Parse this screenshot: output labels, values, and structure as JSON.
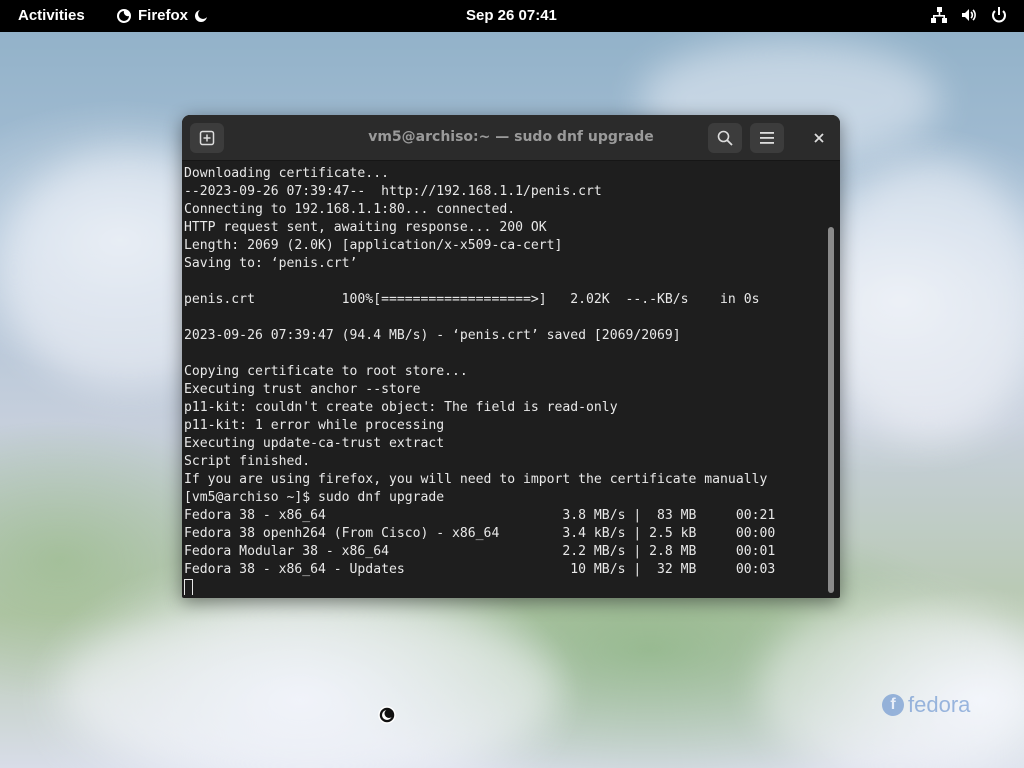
{
  "topbar": {
    "activities": "Activities",
    "app_name": "Firefox",
    "clock": "Sep 26  07:41"
  },
  "window": {
    "title": "vm5@archiso:~ — sudo dnf upgrade"
  },
  "terminal": {
    "lines": [
      "Downloading certificate...",
      "--2023-09-26 07:39:47--  http://192.168.1.1/penis.crt",
      "Connecting to 192.168.1.1:80... connected.",
      "HTTP request sent, awaiting response... 200 OK",
      "Length: 2069 (2.0K) [application/x-x509-ca-cert]",
      "Saving to: ‘penis.crt’",
      "",
      "penis.crt           100%[===================>]   2.02K  --.-KB/s    in 0s",
      "",
      "2023-09-26 07:39:47 (94.4 MB/s) - ‘penis.crt’ saved [2069/2069]",
      "",
      "Copying certificate to root store...",
      "Executing trust anchor --store",
      "p11-kit: couldn't create object: The field is read-only",
      "p11-kit: 1 error while processing",
      "Executing update-ca-trust extract",
      "Script finished.",
      "If you are using firefox, you will need to import the certificate manually",
      "[vm5@archiso ~]$ sudo dnf upgrade",
      "Fedora 38 - x86_64                              3.8 MB/s |  83 MB     00:21",
      "Fedora 38 openh264 (From Cisco) - x86_64        3.4 kB/s | 2.5 kB     00:00",
      "Fedora Modular 38 - x86_64                      2.2 MB/s | 2.8 MB     00:01",
      "Fedora 38 - x86_64 - Updates                     10 MB/s |  32 MB     00:03"
    ]
  },
  "desktop": {
    "logo_text": "fedora"
  },
  "icons": {
    "app": "firefox-icon",
    "night_light": "night-light-icon",
    "network": "network-icon",
    "volume": "volume-icon",
    "power": "power-icon",
    "new_tab": "new-tab-icon",
    "search": "search-icon",
    "menu": "hamburger-menu-icon",
    "close": "close-icon"
  }
}
